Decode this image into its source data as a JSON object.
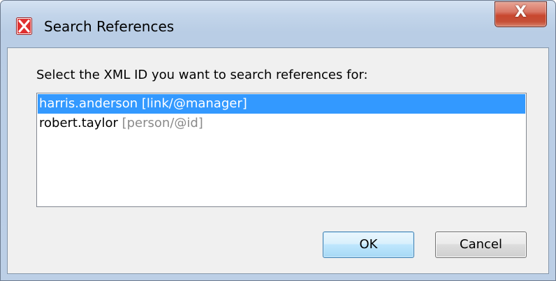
{
  "window": {
    "title": "Search References",
    "close_glyph": "X"
  },
  "dialog": {
    "prompt": "Select the XML ID you want to search references for:",
    "items": [
      {
        "id": "harris.anderson",
        "path": "[link/@manager]",
        "selected": true
      },
      {
        "id": "robert.taylor",
        "path": "[person/@id]",
        "selected": false
      }
    ],
    "ok_label": "OK",
    "cancel_label": "Cancel"
  },
  "colors": {
    "selection": "#3399ff",
    "client_bg": "#f0f0f0",
    "close_button": "#c8472f",
    "path_text": "#8a8a8a"
  },
  "icons": {
    "app": "oxygen-x-icon",
    "close": "close-icon"
  }
}
